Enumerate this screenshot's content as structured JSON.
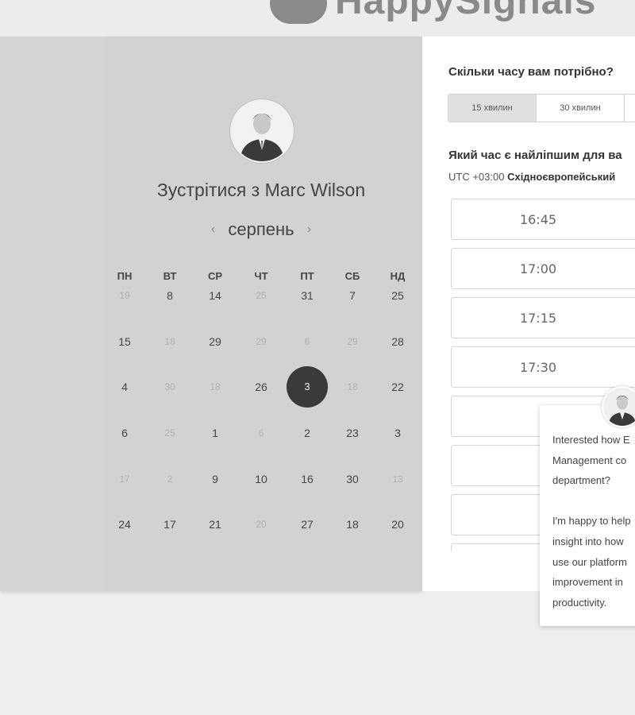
{
  "brand": {
    "name": "HappySignals"
  },
  "calendar": {
    "title": "Зустрітися з Marc Wilson",
    "month": "серпень",
    "prev_icon": "‹",
    "next_icon": "›",
    "weekdays": [
      "ПН",
      "ВТ",
      "СР",
      "ЧТ",
      "ПТ",
      "СБ",
      "НД"
    ],
    "weeks": [
      [
        {
          "d": "19",
          "muted": true
        },
        {
          "d": "8"
        },
        {
          "d": "14"
        },
        {
          "d": "25",
          "muted": true
        },
        {
          "d": "31"
        },
        {
          "d": "7"
        },
        {
          "d": "25"
        }
      ],
      [
        {
          "d": "15"
        },
        {
          "d": "18",
          "muted": true
        },
        {
          "d": "29"
        },
        {
          "d": "29",
          "muted": true
        },
        {
          "d": "6",
          "muted": true
        },
        {
          "d": "29",
          "muted": true
        },
        {
          "d": "28"
        }
      ],
      [
        {
          "d": "4"
        },
        {
          "d": "30",
          "muted": true
        },
        {
          "d": "18",
          "muted": true
        },
        {
          "d": "26"
        },
        {
          "d": "3",
          "selected": true
        },
        {
          "d": "18",
          "muted": true
        },
        {
          "d": "22"
        }
      ],
      [
        {
          "d": "6"
        },
        {
          "d": "25",
          "muted": true
        },
        {
          "d": "1"
        },
        {
          "d": "6",
          "muted": true
        },
        {
          "d": "2"
        },
        {
          "d": "23"
        },
        {
          "d": "3"
        }
      ],
      [
        {
          "d": "17",
          "muted": true
        },
        {
          "d": "2",
          "muted": true
        },
        {
          "d": "9"
        },
        {
          "d": "10"
        },
        {
          "d": "16"
        },
        {
          "d": "30"
        },
        {
          "d": "13",
          "muted": true
        }
      ],
      [
        {
          "d": "24"
        },
        {
          "d": "17"
        },
        {
          "d": "21"
        },
        {
          "d": "20",
          "muted": true
        },
        {
          "d": "27"
        },
        {
          "d": "18"
        },
        {
          "d": "20"
        }
      ]
    ]
  },
  "duration": {
    "question": "Скільки часу вам потрібно?",
    "options": [
      "15 хвилин",
      "30 хвилин",
      ""
    ],
    "selected_index": 0
  },
  "time": {
    "question": "Який час є найліпшим для ва",
    "tz_offset": "UTC +03:00",
    "tz_name": "Східноєвропейський",
    "slots": [
      "16:45",
      "17:00",
      "17:15",
      "17:30",
      "",
      "",
      "",
      ""
    ]
  },
  "chat": {
    "message": "Interested how E\nManagement co\ndepartment?\n\nI'm happy to help\ninsight into how \nuse our platform\nimprovement in \nproductivity."
  }
}
